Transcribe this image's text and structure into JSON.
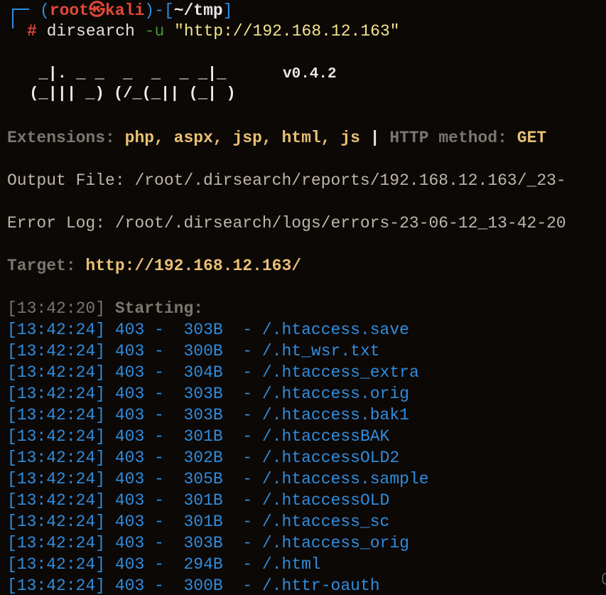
{
  "prompt": {
    "open_bracket": "(",
    "user": "root",
    "skull": "㉿",
    "host": "kali",
    "close_bracket": ")",
    "dash": "-",
    "cwd_open": "[",
    "cwd": "~/tmp",
    "cwd_close": "]",
    "hash": "#",
    "command": "dirsearch",
    "flag": "-u",
    "arg": "\"http://192.168.12.163\""
  },
  "banner": {
    "line1": "  _|. _ _  _  _  _ _|_",
    "line2": " (_||| _) (/_(_|| (_| )",
    "version": "v0.4.2"
  },
  "info": {
    "extensions_label": "Extensions: ",
    "extensions_value": "php, aspx, jsp, html, js",
    "separator": " | ",
    "method_label": "HTTP method: ",
    "method_value": "GET",
    "output_label": "Output File: ",
    "output_value": "/root/.dirsearch/reports/192.168.12.163/_23-",
    "error_label": "Error Log: ",
    "error_value": "/root/.dirsearch/logs/errors-23-06-12_13-42-20",
    "target_label": "Target: ",
    "target_value": "http://192.168.12.163/"
  },
  "start": {
    "time": "[13:42:20]",
    "text": "Starting:"
  },
  "results": [
    {
      "time": "[13:42:24]",
      "status": "403",
      "size": "303B",
      "path": "/.htaccess.save"
    },
    {
      "time": "[13:42:24]",
      "status": "403",
      "size": "300B",
      "path": "/.ht_wsr.txt"
    },
    {
      "time": "[13:42:24]",
      "status": "403",
      "size": "304B",
      "path": "/.htaccess_extra"
    },
    {
      "time": "[13:42:24]",
      "status": "403",
      "size": "303B",
      "path": "/.htaccess.orig"
    },
    {
      "time": "[13:42:24]",
      "status": "403",
      "size": "303B",
      "path": "/.htaccess.bak1"
    },
    {
      "time": "[13:42:24]",
      "status": "403",
      "size": "301B",
      "path": "/.htaccessBAK"
    },
    {
      "time": "[13:42:24]",
      "status": "403",
      "size": "302B",
      "path": "/.htaccessOLD2"
    },
    {
      "time": "[13:42:24]",
      "status": "403",
      "size": "305B",
      "path": "/.htaccess.sample"
    },
    {
      "time": "[13:42:24]",
      "status": "403",
      "size": "301B",
      "path": "/.htaccessOLD"
    },
    {
      "time": "[13:42:24]",
      "status": "403",
      "size": "301B",
      "path": "/.htaccess_sc"
    },
    {
      "time": "[13:42:24]",
      "status": "403",
      "size": "303B",
      "path": "/.htaccess_orig"
    },
    {
      "time": "[13:42:24]",
      "status": "403",
      "size": "294B",
      "path": "/.html"
    },
    {
      "time": "[13:42:24]",
      "status": "403",
      "size": "300B",
      "path": "/.httr-oauth"
    }
  ],
  "colors": {
    "background": "#0c0806",
    "prompt_blue": "#2f8dde",
    "root_red": "#e0483a",
    "result_blue": "#2f8dde",
    "highlight_yellow": "#e8c074",
    "label_grey": "#7b776f"
  }
}
